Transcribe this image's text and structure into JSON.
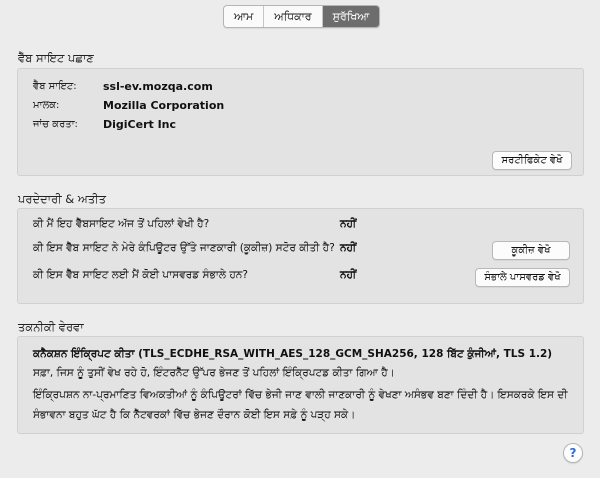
{
  "tabs": [
    "ਆਮ",
    "ਅਧਿਕਾਰ",
    "ਸੁਰੱਖਿਆ"
  ],
  "active_tab": 2,
  "identity": {
    "title": "ਵੈੱਬ ਸਾਇਟ ਪਛਾਣ",
    "website_label": "ਵੈੱਬ ਸਾਇਟ:",
    "website_value": "ssl-ev.mozqa.com",
    "owner_label": "ਮਾਲਕ:",
    "owner_value": "Mozilla Corporation",
    "verifier_label": "ਜਾਂਚ ਕਰਤਾ:",
    "verifier_value": "DigiCert Inc",
    "view_cert_button": "ਸਰਟੀਫਿਕੇਟ ਵੇਖੋ"
  },
  "privacy": {
    "title": "ਪਰਦੇਦਾਰੀ & ਅਤੀਤ",
    "q1": "ਕੀ ਮੈਂ ਇਹ ਵੈੱਬਸਾਇਟ ਅੱਜ ਤੋਂ ਪਹਿਲਾਂ ਵੇਖੀ ਹੈ?",
    "a1": "ਨਹੀਂ",
    "q2": "ਕੀ ਇਸ ਵੈੱਬ ਸਾਇਟ ਨੇ ਮੇਰੇ ਕੰਪਿਊਟਰ ਉੱਤੇ ਜਾਣਕਾਰੀ (ਕੂਕੀਜ਼) ਸਟੋਰ ਕੀਤੀ ਹੈ?",
    "a2": "ਨਹੀਂ",
    "cookies_button": "ਕੂਕੀਜ਼ ਵੇਖੋ",
    "q3": "ਕੀ ਇਸ ਵੈੱਬ ਸਾਇਟ ਲਈ ਮੈਂ ਕੋਈ ਪਾਸਵਰਡ ਸੰਭਾਲੇ ਹਨ?",
    "a3": "ਨਹੀਂ",
    "passwords_button": "ਸੰਭਾਲੇ ਪਾਸਵਰਡ ਵੇਖੋ"
  },
  "technical": {
    "title": "ਤਕਨੀਕੀ ਵੇਰਵਾ",
    "line1": "ਕਨੈਕਸ਼ਨ ਇੰਕ੍ਰਿਪਟ ਕੀਤਾ (TLS_ECDHE_RSA_WITH_AES_128_GCM_SHA256, 128 ਬਿੱਟ ਕੁੰਜੀਆਂ, TLS 1.2)",
    "line2": "ਸਫ਼ਾ, ਜਿਸ ਨੂੰ ਤੁਸੀਂ ਵੇਖ ਰਹੇ ਹੋ, ਇੰਟਰਨੈੱਟ ਉੱਪਰ ਭੇਜਣ ਤੋਂ ਪਹਿਲਾਂ ਇੰਕ੍ਰਿਪਟਡ ਕੀਤਾ ਗਿਆ ਹੈ।",
    "line3": "ਇੰਕ੍ਰਿਪਸ਼ਨ ਨਾ-ਪ੍ਰਮਾਣਿਤ ਵਿਅਕਤੀਆਂ ਨੂੰ ਕੰਪਿਊਟਰਾਂ ਵਿੱਚ ਭੇਜੀ ਜਾਣ ਵਾਲੀ ਜਾਣਕਾਰੀ ਨੂੰ ਵੇਖਣਾ ਅਸੰਭਵ ਬਣਾ ਦਿੰਦੀ ਹੈ। ਇਸਕਰਕੇ ਇਸ ਦੀ ਸੰਭਾਵਨਾ ਬਹੁਤ ਘੱਟ ਹੈ ਕਿ ਨੈੱਟਵਰਕਾਂ ਵਿੱਚ ਭੇਜਣ ਦੌਰਾਨ ਕੋਈ ਇਸ ਸਫ਼ੇ ਨੂੰ ਪੜ੍ਹ ਸਕੇ।"
  },
  "help_label": "?"
}
